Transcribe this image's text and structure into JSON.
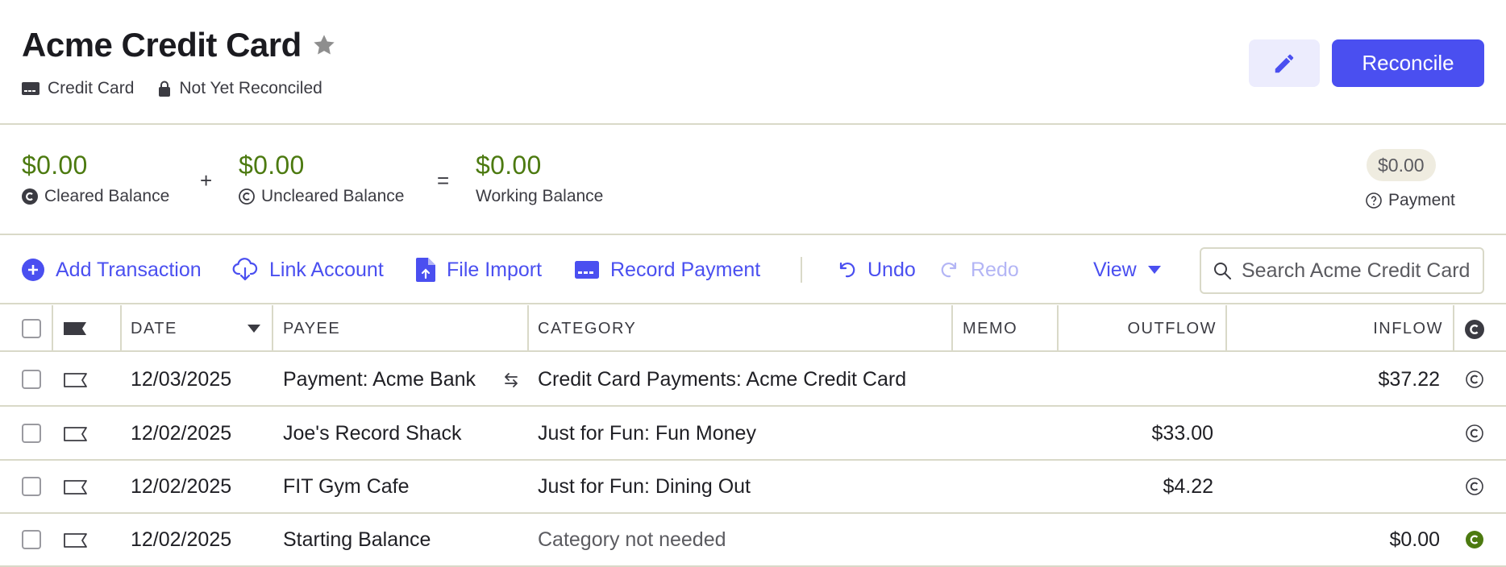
{
  "account": {
    "title": "Acme Credit Card",
    "type_label": "Credit Card",
    "reconcile_status": "Not Yet Reconciled",
    "reconcile_button": "Reconcile",
    "edit_icon": "pencil-icon",
    "star_icon": "star-icon"
  },
  "balances": {
    "cleared": {
      "amount": "$0.00",
      "label": "Cleared Balance"
    },
    "plus": "+",
    "uncleared": {
      "amount": "$0.00",
      "label": "Uncleared Balance"
    },
    "equals": "=",
    "working": {
      "amount": "$0.00",
      "label": "Working Balance"
    },
    "payment": {
      "amount": "$0.00",
      "label": "Payment"
    }
  },
  "toolbar": {
    "add_transaction": "Add Transaction",
    "link_account": "Link Account",
    "file_import": "File Import",
    "record_payment": "Record Payment",
    "undo": "Undo",
    "redo": "Redo",
    "view": "View",
    "search_placeholder": "Search Acme Credit Card"
  },
  "table": {
    "columns": {
      "date": "DATE",
      "payee": "PAYEE",
      "category": "CATEGORY",
      "memo": "MEMO",
      "outflow": "OUTFLOW",
      "inflow": "INFLOW"
    },
    "rows": [
      {
        "date": "12/03/2025",
        "payee": "Payment: Acme Bank",
        "transfer": true,
        "category": "Credit Card Payments: Acme Credit Card",
        "category_muted": false,
        "memo": "",
        "outflow": "",
        "inflow": "$37.22",
        "cleared": false
      },
      {
        "date": "12/02/2025",
        "payee": "Joe's Record Shack",
        "transfer": false,
        "category": "Just for Fun: Fun Money",
        "category_muted": false,
        "memo": "",
        "outflow": "$33.00",
        "inflow": "",
        "cleared": false
      },
      {
        "date": "12/02/2025",
        "payee": "FIT Gym Cafe",
        "transfer": false,
        "category": "Just for Fun: Dining Out",
        "category_muted": false,
        "memo": "",
        "outflow": "$4.22",
        "inflow": "",
        "cleared": false
      },
      {
        "date": "12/02/2025",
        "payee": "Starting Balance",
        "transfer": false,
        "category": "Category not needed",
        "category_muted": true,
        "memo": "",
        "outflow": "",
        "inflow": "$0.00",
        "cleared": true
      }
    ]
  },
  "colors": {
    "accent": "#4a4ff0",
    "balance_green": "#4c7a10",
    "border": "#d9d9c8"
  }
}
